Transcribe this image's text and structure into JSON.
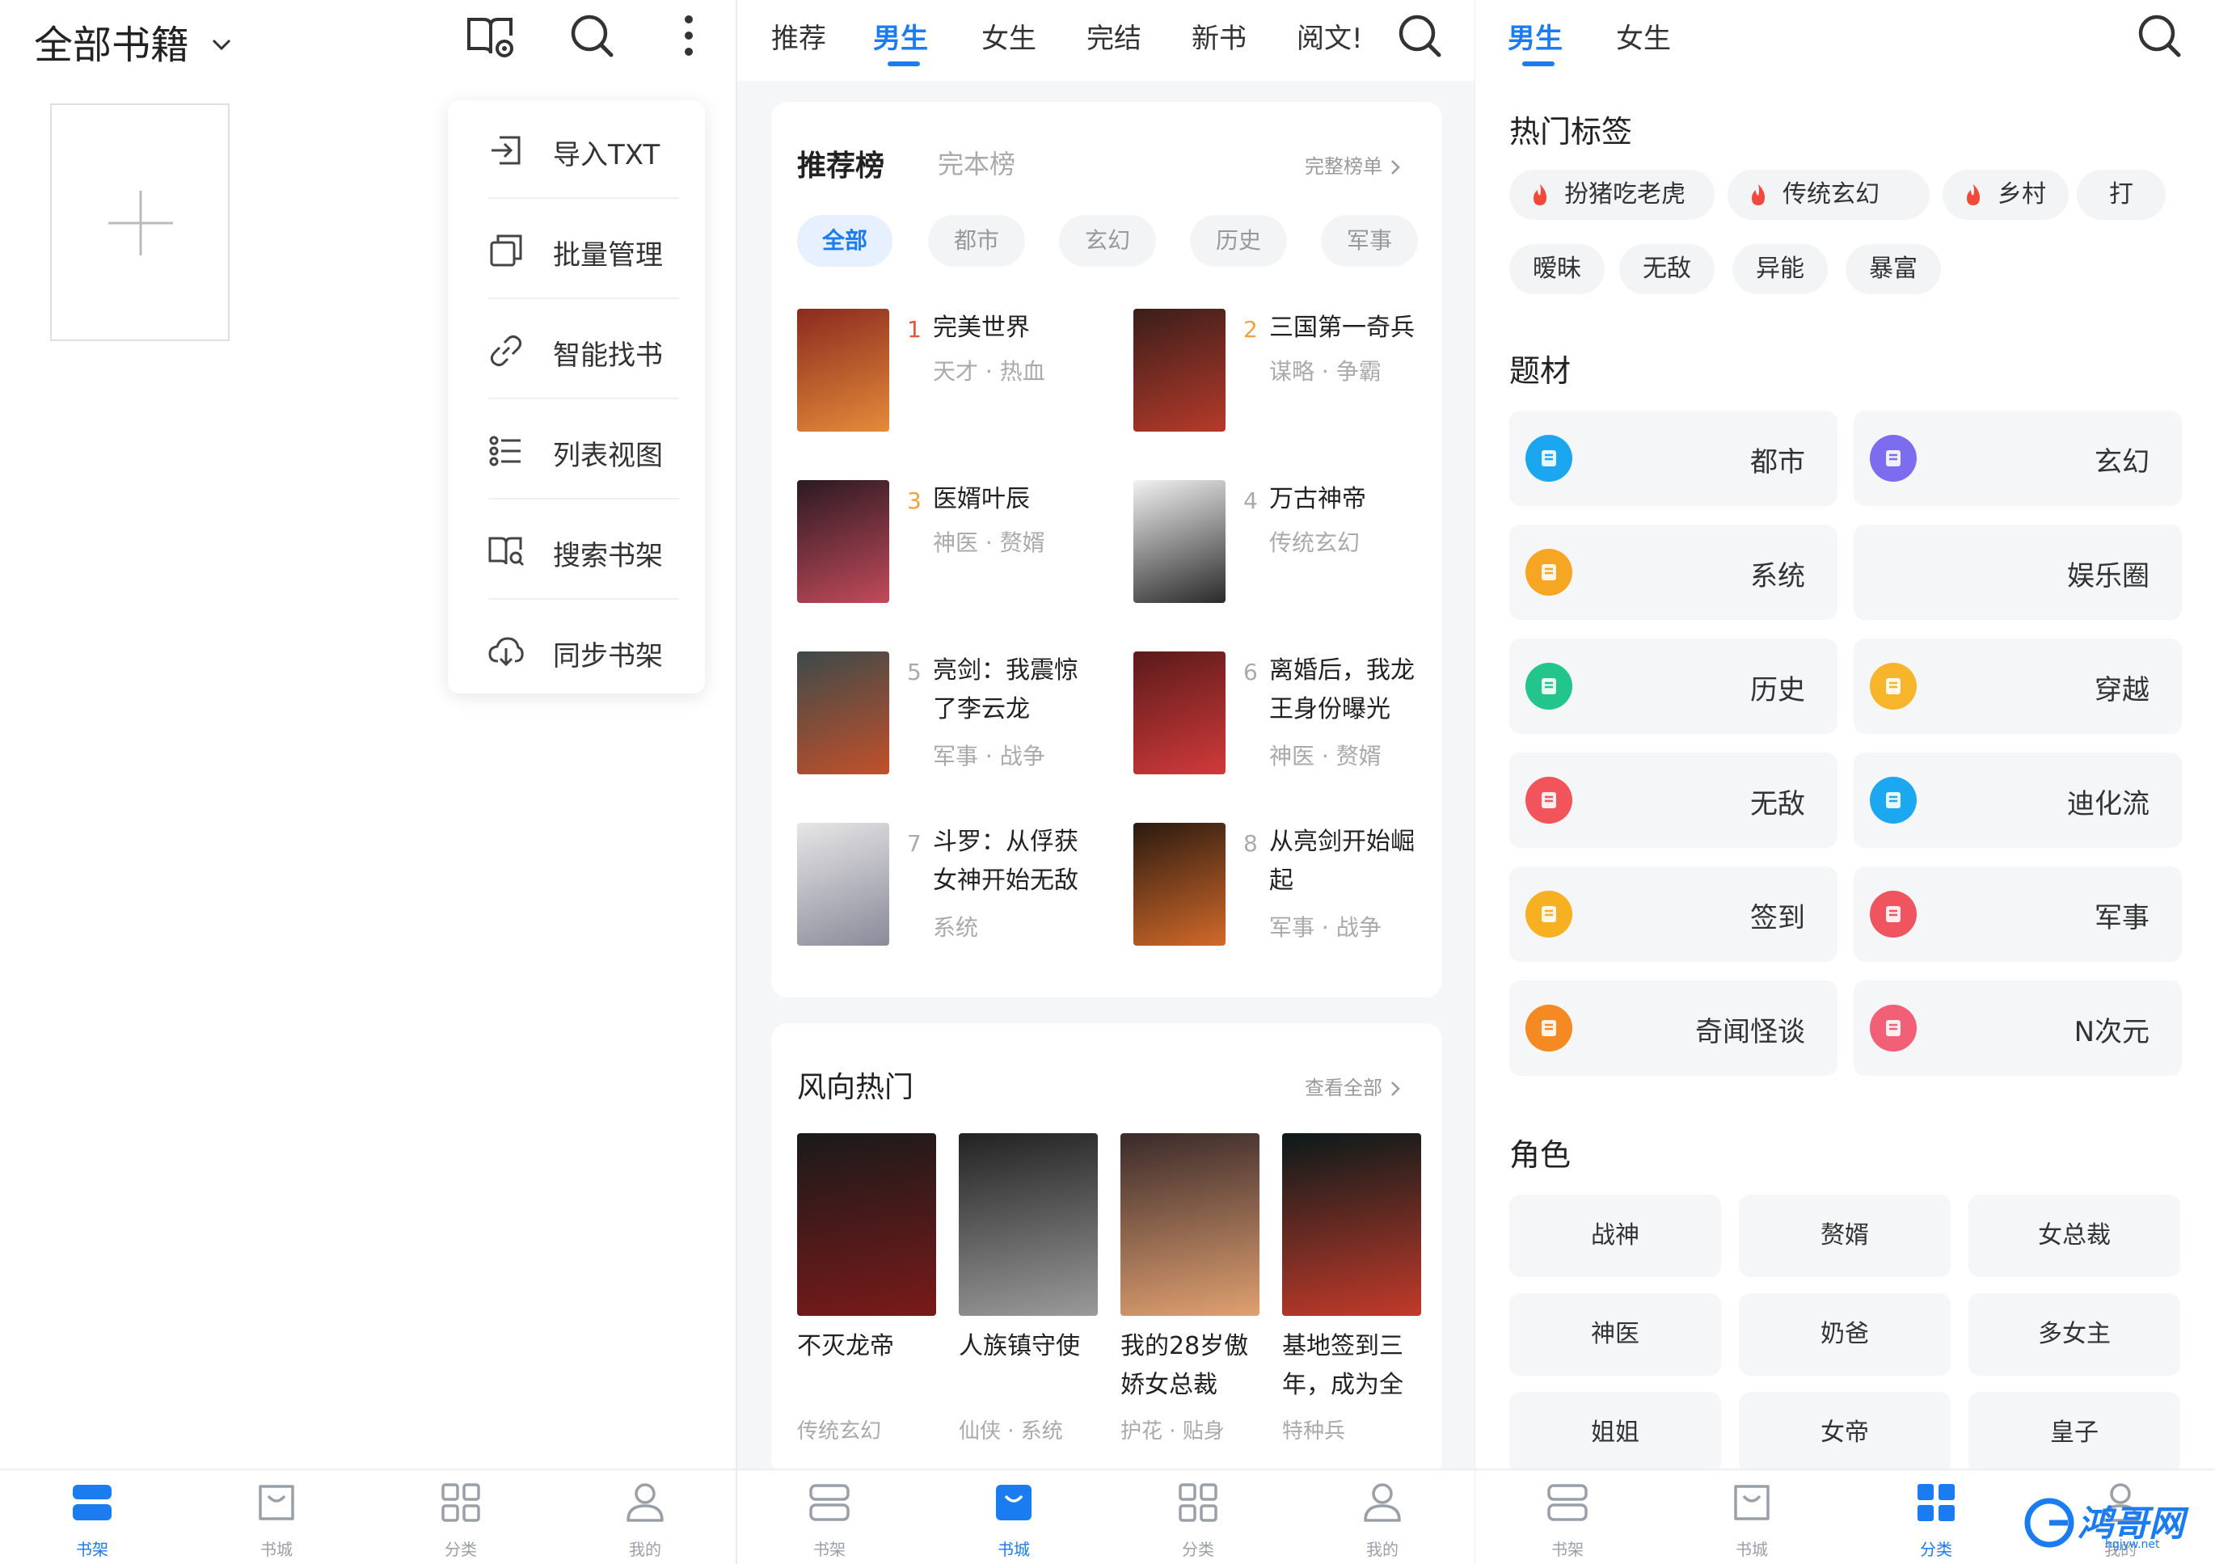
{
  "bookshelf": {
    "title": "全部书籍",
    "menu": [
      {
        "label": "导入TXT",
        "icon": "import-icon"
      },
      {
        "label": "批量管理",
        "icon": "batch-icon"
      },
      {
        "label": "智能找书",
        "icon": "link-icon"
      },
      {
        "label": "列表视图",
        "icon": "list-icon"
      },
      {
        "label": "搜索书架",
        "icon": "search-book-icon"
      },
      {
        "label": "同步书架",
        "icon": "cloud-sync-icon"
      }
    ]
  },
  "store": {
    "tabs": [
      "推荐",
      "男生",
      "女生",
      "完结",
      "新书",
      "阅文!"
    ],
    "active_tab": "男生",
    "rank": {
      "title": "推荐榜",
      "subtitle": "完本榜",
      "more": "完整榜单",
      "chips": [
        "全部",
        "都市",
        "玄幻",
        "历史",
        "军事"
      ],
      "items": [
        {
          "num": "1",
          "title": "完美世界",
          "tags": "天才 · 热血",
          "cover": [
            "#8a2a1f",
            "#e58b3a"
          ]
        },
        {
          "num": "2",
          "title": "三国第一奇兵",
          "tags": "谋略 · 争霸",
          "cover": [
            "#3a1e1a",
            "#b63a2a"
          ]
        },
        {
          "num": "3",
          "title": "医婿叶辰",
          "tags": "神医 · 赘婿",
          "cover": [
            "#2b1a22",
            "#c24a5a"
          ]
        },
        {
          "num": "4",
          "title": "万古神帝",
          "tags": "传统玄幻",
          "cover": [
            "#f1f1f1",
            "#2a2a2a"
          ]
        },
        {
          "num": "5",
          "title": "亮剑：我震惊了李云龙",
          "tags": "军事 · 战争",
          "cover": [
            "#3d4a4a",
            "#c2502a"
          ]
        },
        {
          "num": "6",
          "title": "离婚后，我龙王身份曝光",
          "tags": "神医 · 赘婿",
          "cover": [
            "#5a1a1a",
            "#d23a3a"
          ]
        },
        {
          "num": "7",
          "title": "斗罗：从俘获女神开始无敌",
          "tags": "系统",
          "cover": [
            "#e6e6e6",
            "#8a8a9a"
          ]
        },
        {
          "num": "8",
          "title": "从亮剑开始崛起",
          "tags": "军事 · 战争",
          "cover": [
            "#2a1a10",
            "#d26a2a"
          ]
        }
      ]
    },
    "hot": {
      "title": "风向热门",
      "more": "查看全部",
      "items": [
        {
          "title": "不灭龙帝",
          "tags": "传统玄幻",
          "cover": [
            "#1a1a1a",
            "#7a1a1a"
          ]
        },
        {
          "title": "人族镇守使",
          "tags": "仙侠 · 系统",
          "cover": [
            "#222222",
            "#9a9a9a"
          ]
        },
        {
          "title": "我的28岁傲娇女总裁",
          "tags": "护花 · 贴身",
          "cover": [
            "#3a2a2a",
            "#e0a070"
          ]
        },
        {
          "title": "基地签到三年，成为全",
          "tags": "特种兵",
          "cover": [
            "#0a1a1a",
            "#c23a2a"
          ]
        }
      ]
    }
  },
  "category": {
    "tabs": [
      "男生",
      "女生"
    ],
    "active_tab": "男生",
    "hot_tags_title": "热门标签",
    "hot_tags": [
      {
        "label": "扮猪吃老虎",
        "fire": true
      },
      {
        "label": "传统玄幻",
        "fire": true
      },
      {
        "label": "乡村",
        "fire": true
      },
      {
        "label": "打",
        "fire": false
      },
      {
        "label": "暧昧",
        "fire": false
      },
      {
        "label": "无敌",
        "fire": false
      },
      {
        "label": "异能",
        "fire": false
      },
      {
        "label": "暴富",
        "fire": false
      }
    ],
    "genre_title": "题材",
    "genres": [
      {
        "label": "都市",
        "color": "#1aa7ef"
      },
      {
        "label": "玄幻",
        "color": "#7b6cf0"
      },
      {
        "label": "系统",
        "color": "#f6a623"
      },
      {
        "label": "娱乐圈",
        "color": ""
      },
      {
        "label": "历史",
        "color": "#22c58b"
      },
      {
        "label": "穿越",
        "color": "#f6b52a"
      },
      {
        "label": "无敌",
        "color": "#f2545b"
      },
      {
        "label": "迪化流",
        "color": "#1ca8f0"
      },
      {
        "label": "签到",
        "color": "#f6b022"
      },
      {
        "label": "军事",
        "color": "#f0545f"
      },
      {
        "label": "奇闻怪谈",
        "color": "#f68a22"
      },
      {
        "label": "N次元",
        "color": "#f26078"
      }
    ],
    "role_title": "角色",
    "roles": [
      "战神",
      "赘婿",
      "女总裁",
      "神医",
      "奶爸",
      "多女主",
      "姐姐",
      "女帝",
      "皇子"
    ]
  },
  "nav": {
    "items": [
      "书架",
      "书城",
      "分类",
      "我的"
    ]
  },
  "colors": {
    "accent": "#1b7cf2",
    "rank_top": "#e8543a",
    "rank_mid": "#f0a33a"
  },
  "watermark": {
    "text": "鸿哥网",
    "sub": "hgjyw.net"
  }
}
